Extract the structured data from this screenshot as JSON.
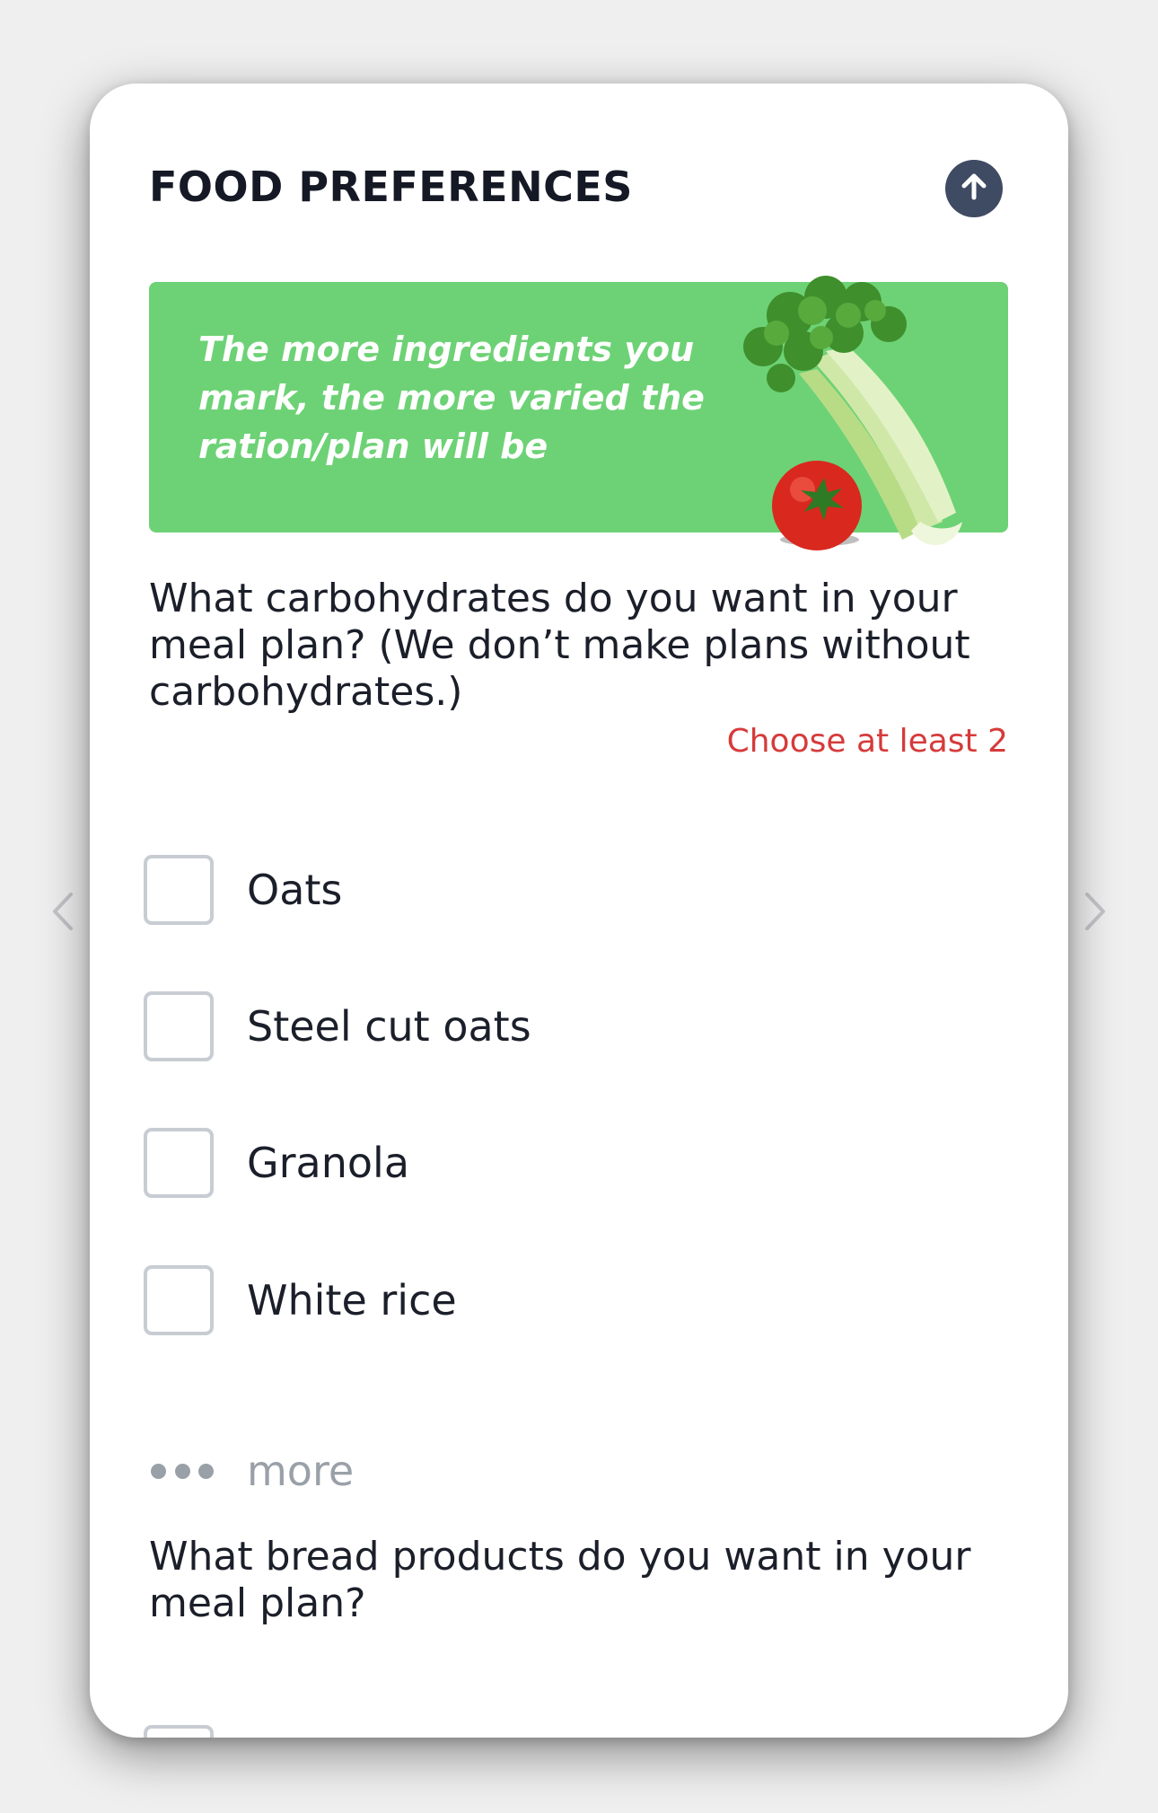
{
  "header": {
    "title": "FOOD PREFERENCES",
    "scroll_up_icon": "arrow-up-icon"
  },
  "banner": {
    "text": "The more ingredients you mark, the more varied the ration/plan will be",
    "background_color": "#6dd275",
    "illustration": "celery-and-tomato"
  },
  "carbs_question": {
    "text": "What carbohydrates do you want in your meal plan? (We don’t make plans without carbohydrates.)",
    "hint": "Choose at least 2",
    "hint_color": "#d63a3a",
    "options": [
      {
        "label": "Oats",
        "checked": false
      },
      {
        "label": "Steel cut oats",
        "checked": false
      },
      {
        "label": "Granola",
        "checked": false
      },
      {
        "label": "White rice",
        "checked": false
      }
    ],
    "more_label": "more"
  },
  "bread_question": {
    "text": "What bread products do you want in your meal plan?"
  },
  "nav": {
    "prev_icon": "chevron-left-icon",
    "next_icon": "chevron-right-icon"
  }
}
